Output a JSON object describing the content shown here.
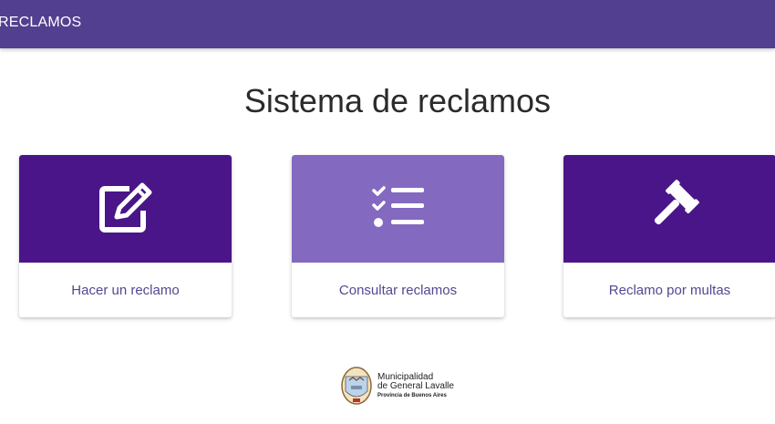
{
  "header": {
    "brand": "RECLAMOS"
  },
  "main": {
    "title": "Sistema de reclamos",
    "cards": [
      {
        "label": "Hacer un reclamo",
        "icon": "edit-icon"
      },
      {
        "label": "Consultar reclamos",
        "icon": "checklist-icon"
      },
      {
        "label": "Reclamo por multas",
        "icon": "gavel-icon"
      }
    ]
  },
  "footer": {
    "logo_line1": "Municipalidad",
    "logo_line2": "de General Lavalle",
    "logo_line3": "Provincia de Buenos Aires"
  },
  "colors": {
    "header": "#533f8f",
    "card_dark": "#4a1588",
    "card_light": "#8369c0",
    "label": "#55478f"
  }
}
